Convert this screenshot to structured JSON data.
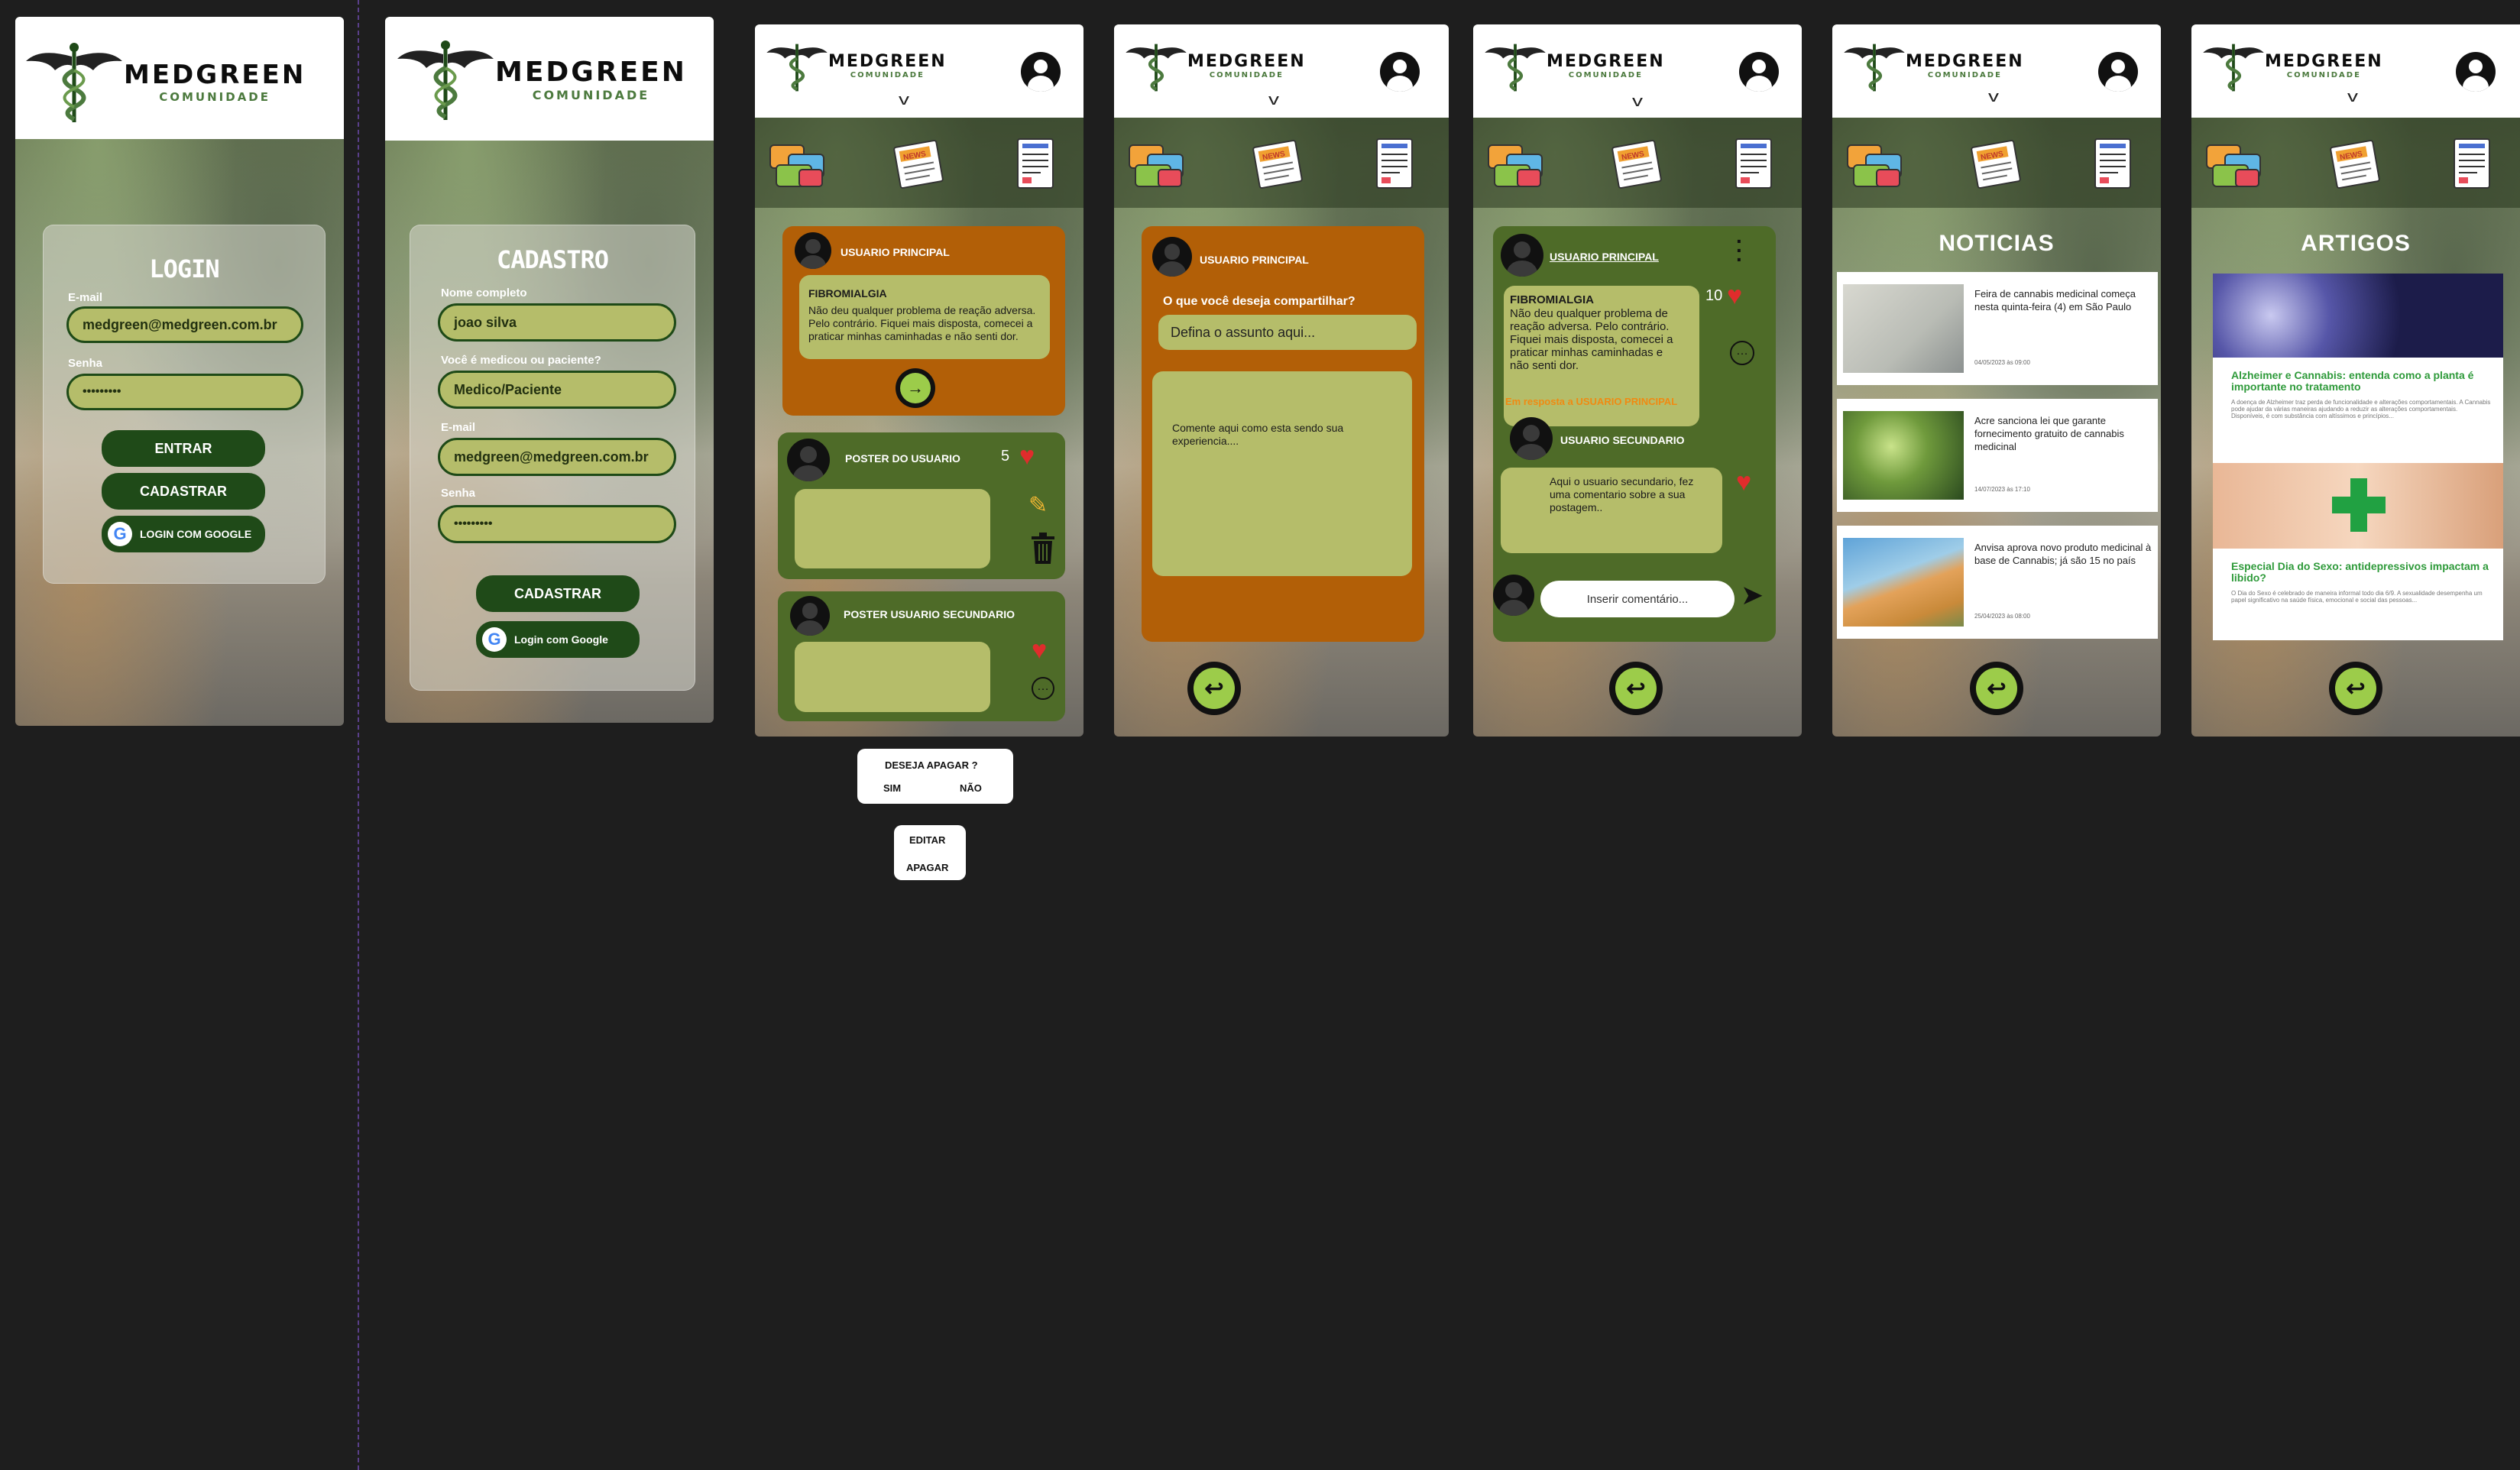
{
  "brand": {
    "name": "MEDGREEN",
    "subtitle": "COMUNIDADE"
  },
  "login": {
    "title": "LOGIN",
    "email_label": "E-mail",
    "email_value": "medgreen@medgreen.com.br",
    "password_label": "Senha",
    "password_value": "•••••••••",
    "enter_button": "ENTRAR",
    "register_button": "CADASTRAR",
    "google_button": "LOGIN COM GOOGLE"
  },
  "cadastro": {
    "title": "CADASTRO",
    "name_label": "Nome completo",
    "name_value": "joao silva",
    "type_label": "Você é medicou ou paciente?",
    "type_value": "Medico/Paciente",
    "email_label": "E-mail",
    "email_value": "medgreen@medgreen.com.br",
    "password_label": "Senha",
    "password_value": "•••••••••",
    "submit_button": "CADASTRAR",
    "google_button": "Login com Google"
  },
  "nav_icons": [
    "forum-icon",
    "news-icon",
    "article-icon"
  ],
  "feed": {
    "main_user": "USUARIO PRINCIPAL",
    "post_title": "FIBROMIALGIA",
    "post_text": "Não deu qualquer problema de reação adversa. Pelo contrário. Fiquei mais disposta, comecei a praticar minhas caminhadas e não senti dor.",
    "poster_user": "POSTER DO USUARIO",
    "poster_likes": "5",
    "poster_secondary": "POSTER USUARIO SECUNDARIO"
  },
  "popups": {
    "delete_question": "DESEJA APAGAR ?",
    "yes": "SIM",
    "no": "NÃO",
    "edit": "EDITAR",
    "delete": "APAGAR"
  },
  "compose": {
    "user": "USUARIO PRINCIPAL",
    "question": "O que você deseja compartilhar?",
    "subject_placeholder": "Defina o assunto aqui...",
    "body_placeholder": "Comente aqui como esta sendo sua experiencia...."
  },
  "thread": {
    "user": "USUARIO PRINCIPAL",
    "post_title": "FIBROMIALGIA",
    "post_text": "Não deu qualquer problema de reação adversa. Pelo contrário. Fiquei mais disposta, comecei a praticar minhas caminhadas e não senti dor.",
    "likes": "10",
    "reply_label": "Em resposta a USUARIO PRINCIPAL",
    "secondary_user": "USUARIO SECUNDARIO",
    "reply_text": "Aqui o usuario secundario, fez uma comentario sobre a sua postagem..",
    "comment_placeholder": "Inserir comentário..."
  },
  "news": {
    "title": "NOTICIAS",
    "items": [
      {
        "title": "Feira de cannabis medicinal começa nesta quinta-feira (4) em São Paulo",
        "date": "04/05/2023 às 09:00"
      },
      {
        "title": "Acre sanciona lei que garante fornecimento gratuito de cannabis medicinal",
        "date": "14/07/2023 às 17:10"
      },
      {
        "title": "Anvisa aprova novo produto medicinal à base de Cannabis; já são 15 no país",
        "date": "25/04/2023 às 08:00"
      }
    ]
  },
  "articles": {
    "title": "ARTIGOS",
    "items": [
      {
        "title": "Alzheimer e Cannabis: entenda como a planta é importante no tratamento",
        "text": "A doença de Alzheimer traz perda de funcionalidade e alterações comportamentais. A Cannabis pode ajudar da várias maneiras ajudando a reduzir as alterações comportamentais. Disponíveis, é com substância com altíssimos e princípios..."
      },
      {
        "title": "Especial Dia do Sexo: antidepressivos impactam a libido?",
        "text": "O Dia do Sexo é celebrado de maneira informal todo dia 6/9. A sexualidade desempenha um papel significativo na saúde física, emocional e social das pessoas..."
      }
    ]
  },
  "colors": {
    "dark_green": "#1f4a18",
    "olive": "#b5bd6a",
    "orange": "#b25f07",
    "green_card": "#4e6b28",
    "heart": "#e02c2c"
  }
}
